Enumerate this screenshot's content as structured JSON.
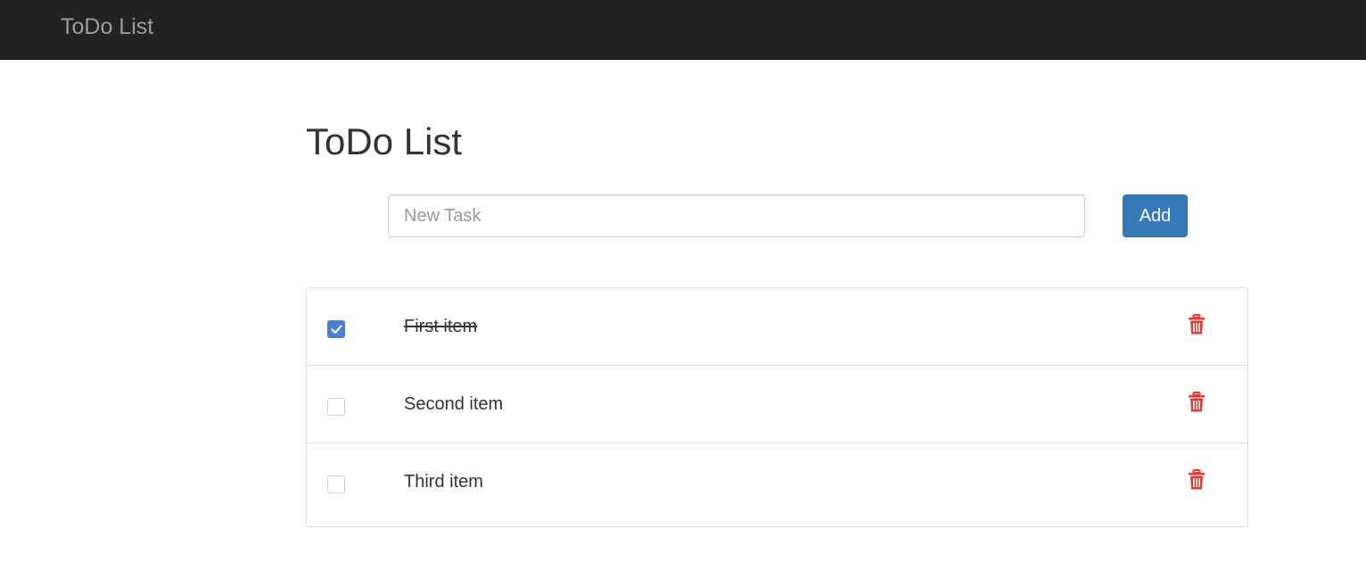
{
  "navbar": {
    "brand": "ToDo List"
  },
  "page": {
    "title": "ToDo List"
  },
  "new_task": {
    "value": "",
    "placeholder": "New Task",
    "add_label": "Add"
  },
  "tasks": [
    {
      "label": "First item",
      "completed": true
    },
    {
      "label": "Second item",
      "completed": false
    },
    {
      "label": "Third item",
      "completed": false
    }
  ],
  "icons": {
    "checkmark": "check-icon",
    "delete": "trash-icon"
  },
  "colors": {
    "navbar_bg": "#222222",
    "brand_text": "#9d9d9d",
    "primary": "#337ab7",
    "checkbox_checked": "#4a7fd4",
    "danger": "#e53935"
  }
}
